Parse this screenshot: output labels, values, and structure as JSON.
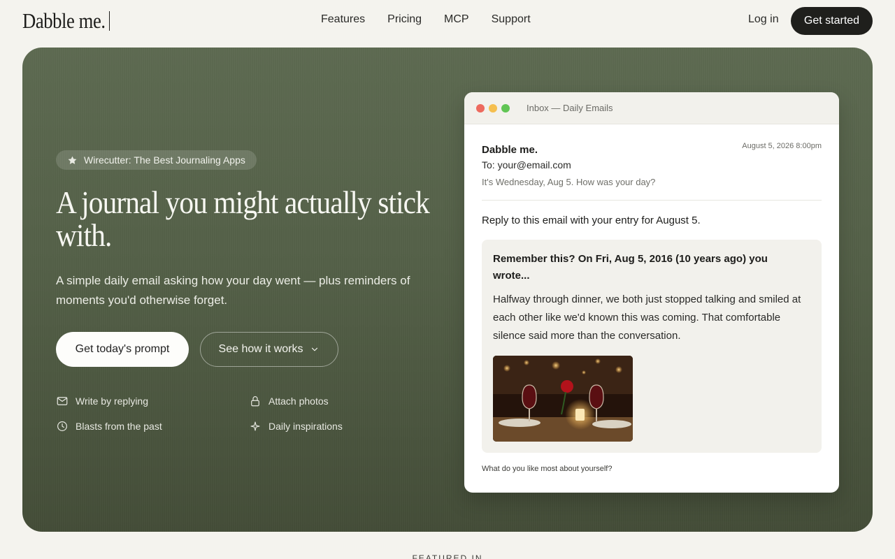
{
  "nav": {
    "logo": "Dabble me.",
    "links": [
      "Features",
      "Pricing",
      "MCP",
      "Support"
    ],
    "login": "Log in",
    "get_started": "Get started"
  },
  "hero": {
    "badge": "Wirecutter: The Best Journaling Apps",
    "headline": "A journal you might actually stick with.",
    "subtext": "A simple daily email asking how your day went — plus reminders of moments you'd otherwise forget.",
    "primary_button": "Get today's prompt",
    "secondary_button": "See how it works",
    "features": [
      {
        "label": "Write by replying",
        "icon": "envelope-icon"
      },
      {
        "label": "Attach photos",
        "icon": "lock-icon"
      },
      {
        "label": "Blasts from the past",
        "icon": "clock-icon"
      },
      {
        "label": "Daily inspirations",
        "icon": "sparkle-icon"
      }
    ]
  },
  "email": {
    "window_title": "Inbox — Daily Emails",
    "from": "Dabble me.",
    "date": "August 5, 2026 8:00pm",
    "to": "To: your@email.com",
    "subject": "It's Wednesday, Aug 5. How was your day?",
    "reply_line": "Reply to this email with your entry for August 5.",
    "memory_title": "Remember this? On Fri, Aug 5, 2016 (10 years ago) you wrote...",
    "memory_body": "Halfway through dinner, we both just stopped talking and smiled at each other like we'd known this was coming. That comfortable silence said more than the conversation.",
    "prompt": "What do you like most about yourself?"
  },
  "footer": {
    "featured": "FEATURED IN"
  },
  "colors": {
    "hero_bg": "#535f47",
    "dark_button": "#1f1f1c",
    "dot_red": "#ed6a5e",
    "dot_yellow": "#f5bf4f",
    "dot_green": "#61c554"
  }
}
